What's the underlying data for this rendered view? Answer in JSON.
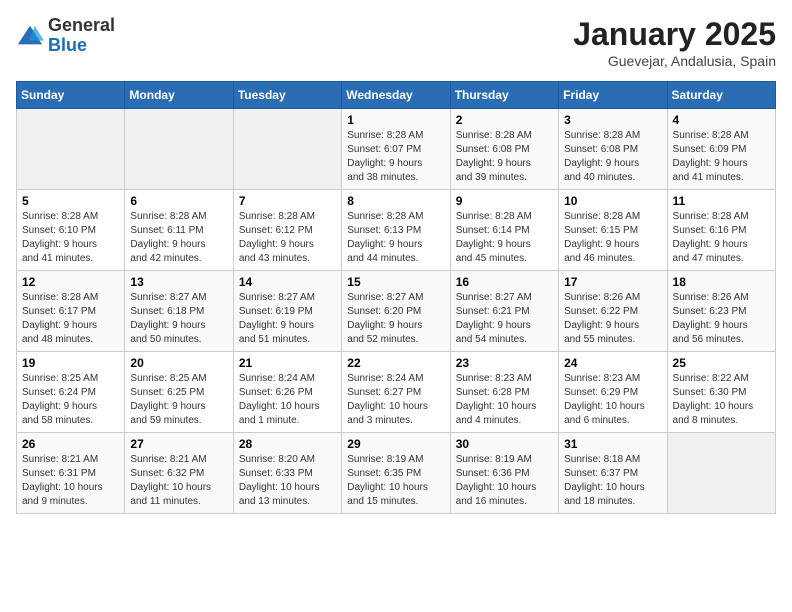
{
  "logo": {
    "general": "General",
    "blue": "Blue"
  },
  "header": {
    "title": "January 2025",
    "subtitle": "Guevejar, Andalusia, Spain"
  },
  "weekdays": [
    "Sunday",
    "Monday",
    "Tuesday",
    "Wednesday",
    "Thursday",
    "Friday",
    "Saturday"
  ],
  "weeks": [
    [
      {
        "day": "",
        "info": ""
      },
      {
        "day": "",
        "info": ""
      },
      {
        "day": "",
        "info": ""
      },
      {
        "day": "1",
        "info": "Sunrise: 8:28 AM\nSunset: 6:07 PM\nDaylight: 9 hours\nand 38 minutes."
      },
      {
        "day": "2",
        "info": "Sunrise: 8:28 AM\nSunset: 6:08 PM\nDaylight: 9 hours\nand 39 minutes."
      },
      {
        "day": "3",
        "info": "Sunrise: 8:28 AM\nSunset: 6:08 PM\nDaylight: 9 hours\nand 40 minutes."
      },
      {
        "day": "4",
        "info": "Sunrise: 8:28 AM\nSunset: 6:09 PM\nDaylight: 9 hours\nand 41 minutes."
      }
    ],
    [
      {
        "day": "5",
        "info": "Sunrise: 8:28 AM\nSunset: 6:10 PM\nDaylight: 9 hours\nand 41 minutes."
      },
      {
        "day": "6",
        "info": "Sunrise: 8:28 AM\nSunset: 6:11 PM\nDaylight: 9 hours\nand 42 minutes."
      },
      {
        "day": "7",
        "info": "Sunrise: 8:28 AM\nSunset: 6:12 PM\nDaylight: 9 hours\nand 43 minutes."
      },
      {
        "day": "8",
        "info": "Sunrise: 8:28 AM\nSunset: 6:13 PM\nDaylight: 9 hours\nand 44 minutes."
      },
      {
        "day": "9",
        "info": "Sunrise: 8:28 AM\nSunset: 6:14 PM\nDaylight: 9 hours\nand 45 minutes."
      },
      {
        "day": "10",
        "info": "Sunrise: 8:28 AM\nSunset: 6:15 PM\nDaylight: 9 hours\nand 46 minutes."
      },
      {
        "day": "11",
        "info": "Sunrise: 8:28 AM\nSunset: 6:16 PM\nDaylight: 9 hours\nand 47 minutes."
      }
    ],
    [
      {
        "day": "12",
        "info": "Sunrise: 8:28 AM\nSunset: 6:17 PM\nDaylight: 9 hours\nand 48 minutes."
      },
      {
        "day": "13",
        "info": "Sunrise: 8:27 AM\nSunset: 6:18 PM\nDaylight: 9 hours\nand 50 minutes."
      },
      {
        "day": "14",
        "info": "Sunrise: 8:27 AM\nSunset: 6:19 PM\nDaylight: 9 hours\nand 51 minutes."
      },
      {
        "day": "15",
        "info": "Sunrise: 8:27 AM\nSunset: 6:20 PM\nDaylight: 9 hours\nand 52 minutes."
      },
      {
        "day": "16",
        "info": "Sunrise: 8:27 AM\nSunset: 6:21 PM\nDaylight: 9 hours\nand 54 minutes."
      },
      {
        "day": "17",
        "info": "Sunrise: 8:26 AM\nSunset: 6:22 PM\nDaylight: 9 hours\nand 55 minutes."
      },
      {
        "day": "18",
        "info": "Sunrise: 8:26 AM\nSunset: 6:23 PM\nDaylight: 9 hours\nand 56 minutes."
      }
    ],
    [
      {
        "day": "19",
        "info": "Sunrise: 8:25 AM\nSunset: 6:24 PM\nDaylight: 9 hours\nand 58 minutes."
      },
      {
        "day": "20",
        "info": "Sunrise: 8:25 AM\nSunset: 6:25 PM\nDaylight: 9 hours\nand 59 minutes."
      },
      {
        "day": "21",
        "info": "Sunrise: 8:24 AM\nSunset: 6:26 PM\nDaylight: 10 hours\nand 1 minute."
      },
      {
        "day": "22",
        "info": "Sunrise: 8:24 AM\nSunset: 6:27 PM\nDaylight: 10 hours\nand 3 minutes."
      },
      {
        "day": "23",
        "info": "Sunrise: 8:23 AM\nSunset: 6:28 PM\nDaylight: 10 hours\nand 4 minutes."
      },
      {
        "day": "24",
        "info": "Sunrise: 8:23 AM\nSunset: 6:29 PM\nDaylight: 10 hours\nand 6 minutes."
      },
      {
        "day": "25",
        "info": "Sunrise: 8:22 AM\nSunset: 6:30 PM\nDaylight: 10 hours\nand 8 minutes."
      }
    ],
    [
      {
        "day": "26",
        "info": "Sunrise: 8:21 AM\nSunset: 6:31 PM\nDaylight: 10 hours\nand 9 minutes."
      },
      {
        "day": "27",
        "info": "Sunrise: 8:21 AM\nSunset: 6:32 PM\nDaylight: 10 hours\nand 11 minutes."
      },
      {
        "day": "28",
        "info": "Sunrise: 8:20 AM\nSunset: 6:33 PM\nDaylight: 10 hours\nand 13 minutes."
      },
      {
        "day": "29",
        "info": "Sunrise: 8:19 AM\nSunset: 6:35 PM\nDaylight: 10 hours\nand 15 minutes."
      },
      {
        "day": "30",
        "info": "Sunrise: 8:19 AM\nSunset: 6:36 PM\nDaylight: 10 hours\nand 16 minutes."
      },
      {
        "day": "31",
        "info": "Sunrise: 8:18 AM\nSunset: 6:37 PM\nDaylight: 10 hours\nand 18 minutes."
      },
      {
        "day": "",
        "info": ""
      }
    ]
  ]
}
